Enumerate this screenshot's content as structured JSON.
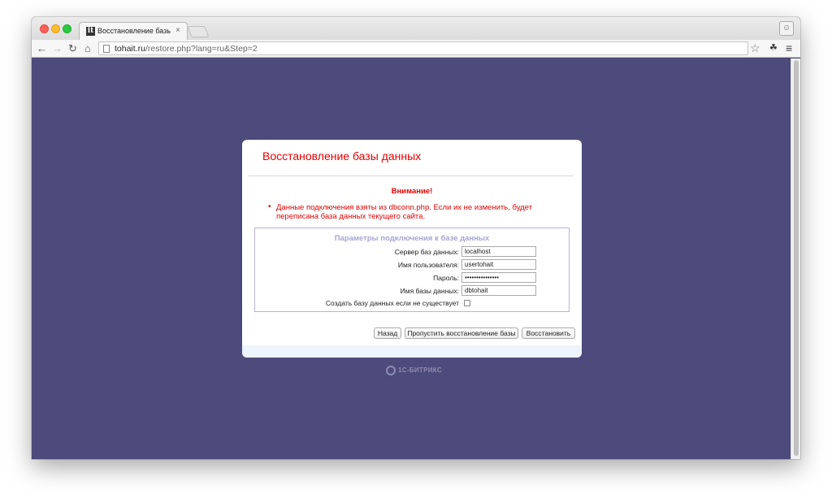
{
  "browser": {
    "tab_title": "Восстановление базы да",
    "tab_favicon": "it",
    "tab_close": "×",
    "url_host": "tohait.ru",
    "url_path": "/restore.php?lang=ru&Step=2"
  },
  "icons": {
    "back": "back-arrow-icon",
    "forward": "forward-arrow-icon",
    "reload": "reload-icon",
    "home": "home-icon",
    "page": "page-icon",
    "star": "star-icon",
    "extension": "evernote-icon",
    "menu": "hamburger-menu-icon",
    "profile": "profile-icon",
    "brand": "bitrix-logo-icon"
  },
  "dialog": {
    "title": "Восстановление базы данных",
    "warning_heading": "Внимание!",
    "warning_text": "Данные подключения взяты из dbconn.php. Если их не изменить, будет переписана база данных текущего сайта.",
    "params_title": "Параметры подключения к базе данных",
    "fields": {
      "server_label": "Сервер баз данных:",
      "server_value": "localhost",
      "user_label": "Имя пользователя:",
      "user_value": "usertohait",
      "password_label": "Пароль:",
      "password_value": "•••••••••••••••",
      "dbname_label": "Имя базы данных:",
      "dbname_value": "dbtohait",
      "create_db_label": "Создать базу данных если не существует"
    },
    "buttons": {
      "back": "Назад",
      "skip": "Пропустить восстановление базы",
      "restore": "Восстановить"
    }
  },
  "brand": {
    "text": "1С-БИТРИКС"
  },
  "colors": {
    "page_bg": "#4d4b7b",
    "accent_red": "#e50000",
    "params_title": "#a7a4d2",
    "footer_strip": "#eef4fb"
  }
}
